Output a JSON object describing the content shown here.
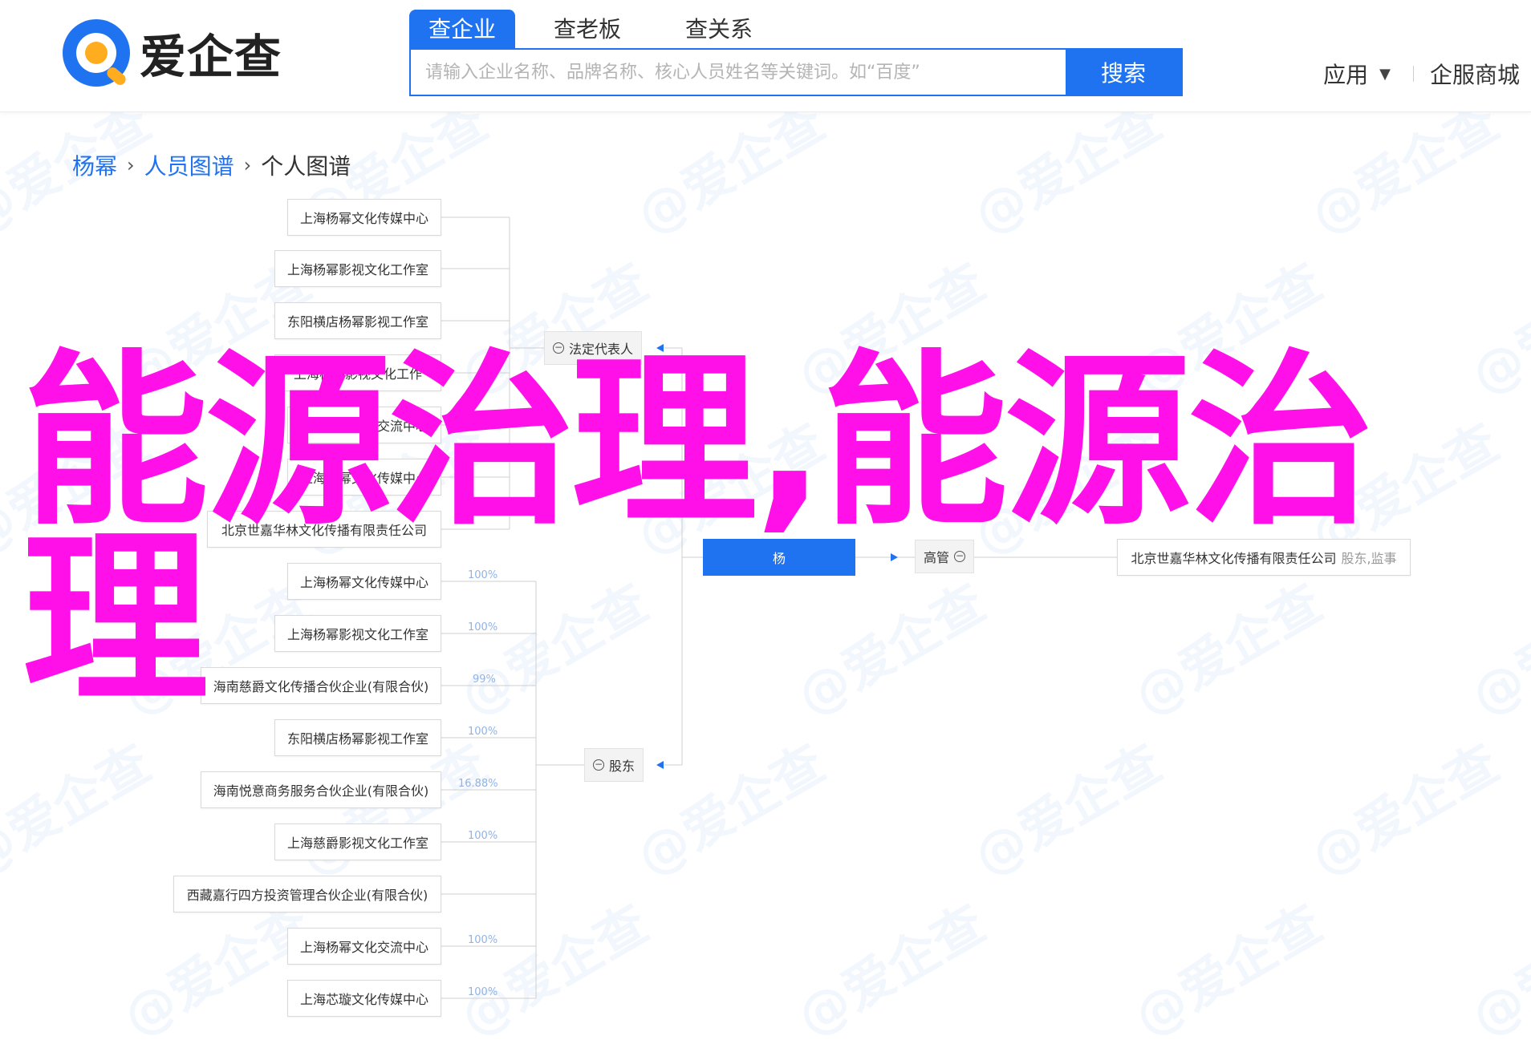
{
  "header": {
    "logo_text": "爱企查",
    "search_tabs": [
      "查企业",
      "查老板",
      "查关系"
    ],
    "search_placeholder": "请输入企业名称、品牌名称、核心人员姓名等关键词。如“百度”",
    "search_button": "搜索",
    "nav_app": "应用",
    "nav_mall": "企服商城"
  },
  "breadcrumb": {
    "items": [
      "杨幂",
      "人员图谱"
    ],
    "current": "个人图谱"
  },
  "graph": {
    "legal_rep_label": "法定代表人",
    "shareholder_label": "股东",
    "center_label": "杨",
    "manager_label": "高管",
    "right_company": "北京世嘉华林文化传播有限责任公司",
    "right_roles": "股东,监事",
    "legal_rep_nodes": [
      "上海杨幂文化传媒中心",
      "上海杨幂影视文化工作室",
      "东阳横店杨幂影视工作室",
      "上海杨幂影视文化工作",
      "上海杨幂文化交流中心",
      "上海杨幂文化传媒中心",
      "北京世嘉华林文化传播有限责任公司"
    ],
    "shareholder_nodes": [
      {
        "name": "上海杨幂文化传媒中心",
        "pct": "100%"
      },
      {
        "name": "上海杨幂影视文化工作室",
        "pct": "100%"
      },
      {
        "name": "海南慈爵文化传播合伙企业(有限合伙)",
        "pct": "99%"
      },
      {
        "name": "东阳横店杨幂影视工作室",
        "pct": "100%"
      },
      {
        "name": "海南悦意商务服务合伙企业(有限合伙)",
        "pct": "16.88%"
      },
      {
        "name": "上海慈爵影视文化工作室",
        "pct": "100%"
      },
      {
        "name": "西藏嘉行四方投资管理合伙企业(有限合伙)",
        "pct": ""
      },
      {
        "name": "上海杨幂文化交流中心",
        "pct": "100%"
      },
      {
        "name": "上海芯璇文化传媒中心",
        "pct": "100%"
      }
    ]
  },
  "overlay": {
    "headline": "能源治理,能源治理"
  },
  "colors": {
    "brand_blue": "#1f73f1",
    "overlay_magenta": "#ff10e8",
    "logo_orange": "#ffad1f"
  }
}
